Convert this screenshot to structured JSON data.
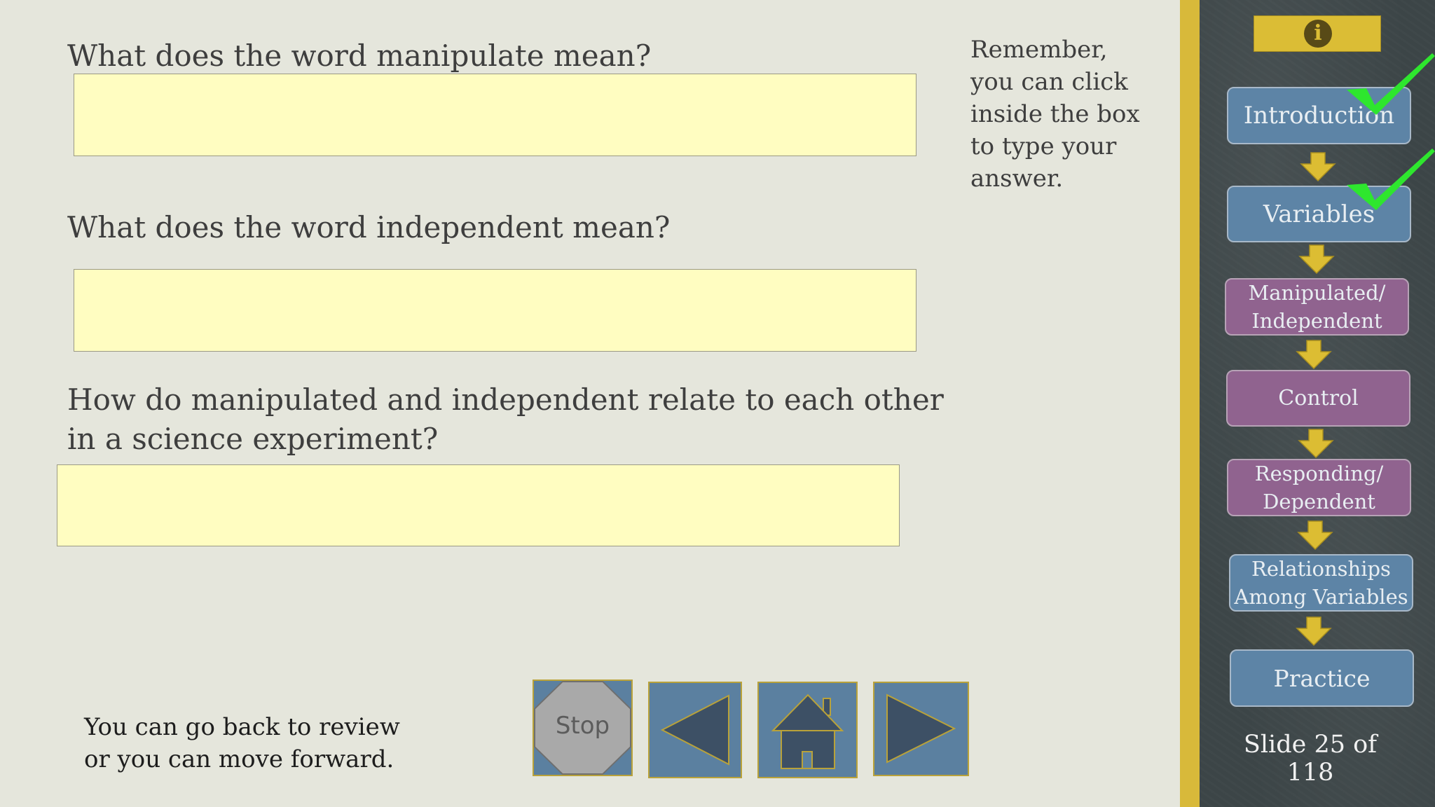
{
  "questions": [
    {
      "text": "What does the word manipulate  mean?",
      "answer": ""
    },
    {
      "text": "What does the word independent mean?",
      "answer": ""
    },
    {
      "text": "How do manipulated and independent relate to each other in a science experiment?",
      "answer": ""
    }
  ],
  "reminder": "Remember, you can click inside the box to type your answer.",
  "nav_note": "You can go back to review or you can move forward.",
  "controls": {
    "stop_label": "Stop",
    "back_icon": "left-triangle-icon",
    "home_icon": "house-icon",
    "forward_icon": "right-triangle-icon"
  },
  "sidebar": {
    "info_icon": "info-icon",
    "steps": [
      {
        "line1": "Introduction",
        "line2": "",
        "completed": true
      },
      {
        "line1": "Variables",
        "line2": "",
        "completed": true
      },
      {
        "line1": "Manipulated/",
        "line2": "Independent",
        "completed": false
      },
      {
        "line1": "Control",
        "line2": "",
        "completed": false
      },
      {
        "line1": "Responding/",
        "line2": "Dependent",
        "completed": false
      },
      {
        "line1": "Relationships",
        "line2": "Among Variables",
        "completed": false
      },
      {
        "line1": "Practice",
        "line2": "",
        "completed": false
      }
    ],
    "slide_counter": "Slide 25 of 118"
  },
  "colors": {
    "answer_fill": "#fffdc1",
    "nav_blue": "#5b80a0",
    "step_blue": "#5d84a6",
    "step_purple": "#90638f",
    "accent_yellow": "#dbbd35",
    "check_green": "#2ee62e"
  }
}
